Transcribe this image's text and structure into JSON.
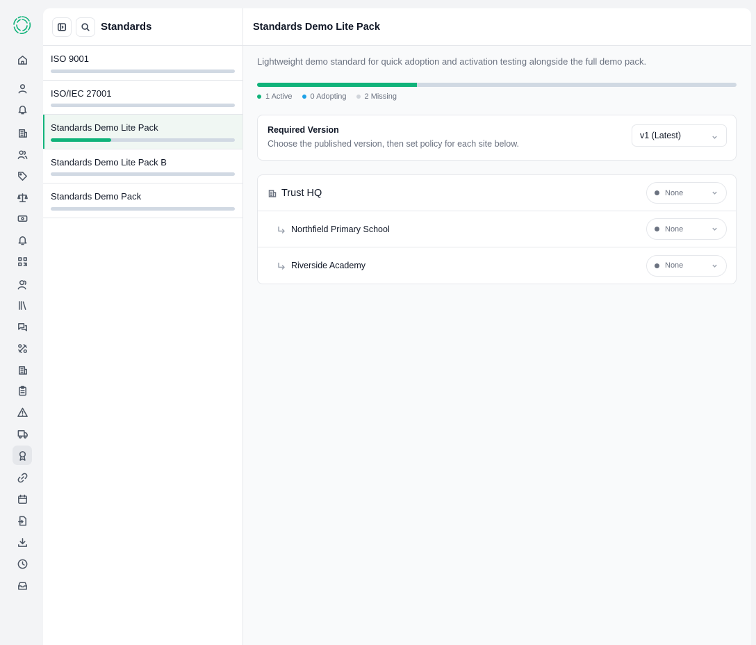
{
  "rail": {
    "icons": [
      "home-icon",
      "user-icon",
      "bell-icon",
      "building-icon",
      "users-icon",
      "tag-icon",
      "scale-icon",
      "banknote-icon",
      "bell-icon",
      "qr-code-icon",
      "users-group-icon",
      "library-icon",
      "messages-icon",
      "tools-icon",
      "building-2-icon",
      "clipboard-icon",
      "alert-triangle-icon",
      "truck-icon",
      "award-icon",
      "link-icon",
      "calendar-icon",
      "file-import-icon",
      "download-icon",
      "clock-icon",
      "inbox-icon"
    ],
    "active_index": 18
  },
  "list": {
    "title": "Standards",
    "items": [
      {
        "name": "ISO 9001",
        "progress": 0.0,
        "selected": false
      },
      {
        "name": "ISO/IEC 27001",
        "progress": 0.0,
        "selected": false
      },
      {
        "name": "Standards Demo Lite Pack",
        "progress": 0.33,
        "selected": true
      },
      {
        "name": "Standards Demo Lite Pack B",
        "progress": 0.0,
        "selected": false
      },
      {
        "name": "Standards Demo Pack",
        "progress": 0.0,
        "selected": false
      }
    ]
  },
  "main": {
    "title": "Standards Demo Lite Pack",
    "description": "Lightweight demo standard for quick adoption and activation testing alongside the full demo pack.",
    "progress": 0.333,
    "legend": [
      {
        "label": "1 Active",
        "color": "#10b37a"
      },
      {
        "label": "0 Adopting",
        "color": "#1ea1e6"
      },
      {
        "label": "2 Missing",
        "color": "#d1d5db"
      }
    ],
    "version": {
      "title": "Required Version",
      "subtitle": "Choose the published version, then set policy for each site below.",
      "selected": "v1 (Latest)"
    },
    "sites": [
      {
        "name": "Trust HQ",
        "policy": "None",
        "level": "top"
      },
      {
        "name": "Northfield Primary School",
        "policy": "None",
        "level": "child"
      },
      {
        "name": "Riverside Academy",
        "policy": "None",
        "level": "child"
      }
    ]
  }
}
